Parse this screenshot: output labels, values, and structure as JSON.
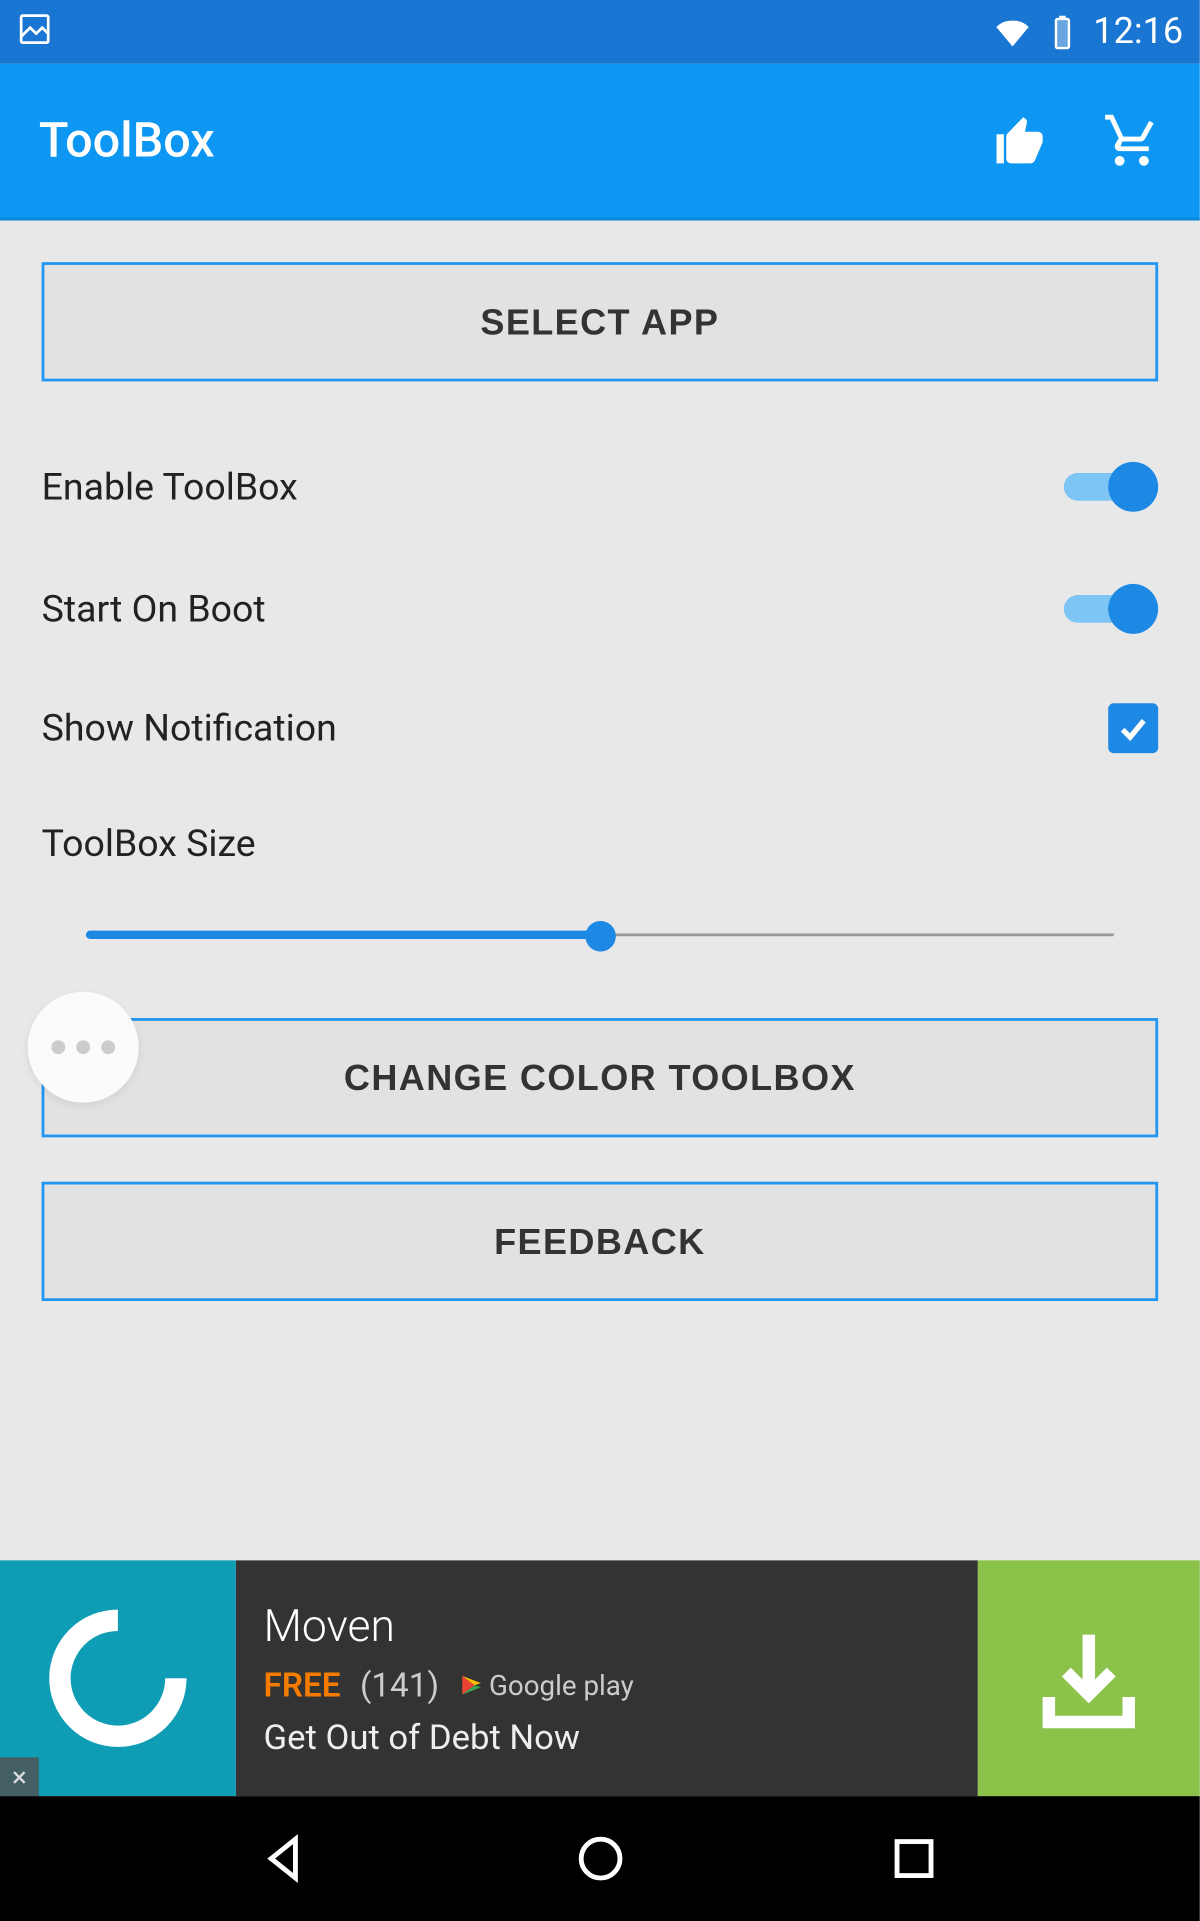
{
  "status": {
    "time": "12:16"
  },
  "appbar": {
    "title": "ToolBox"
  },
  "buttons": {
    "select_app": "SELECT APP",
    "change_color": "CHANGE COLOR TOOLBOX",
    "feedback": "FEEDBACK"
  },
  "settings": {
    "enable_toolbox": "Enable ToolBox",
    "start_on_boot": "Start On Boot",
    "show_notification": "Show Notification",
    "toolbox_size": "ToolBox Size"
  },
  "ad": {
    "title": "Moven",
    "free": "FREE",
    "rating": "(141)",
    "store": "Google play",
    "subtitle": "Get Out of Debt Now"
  }
}
